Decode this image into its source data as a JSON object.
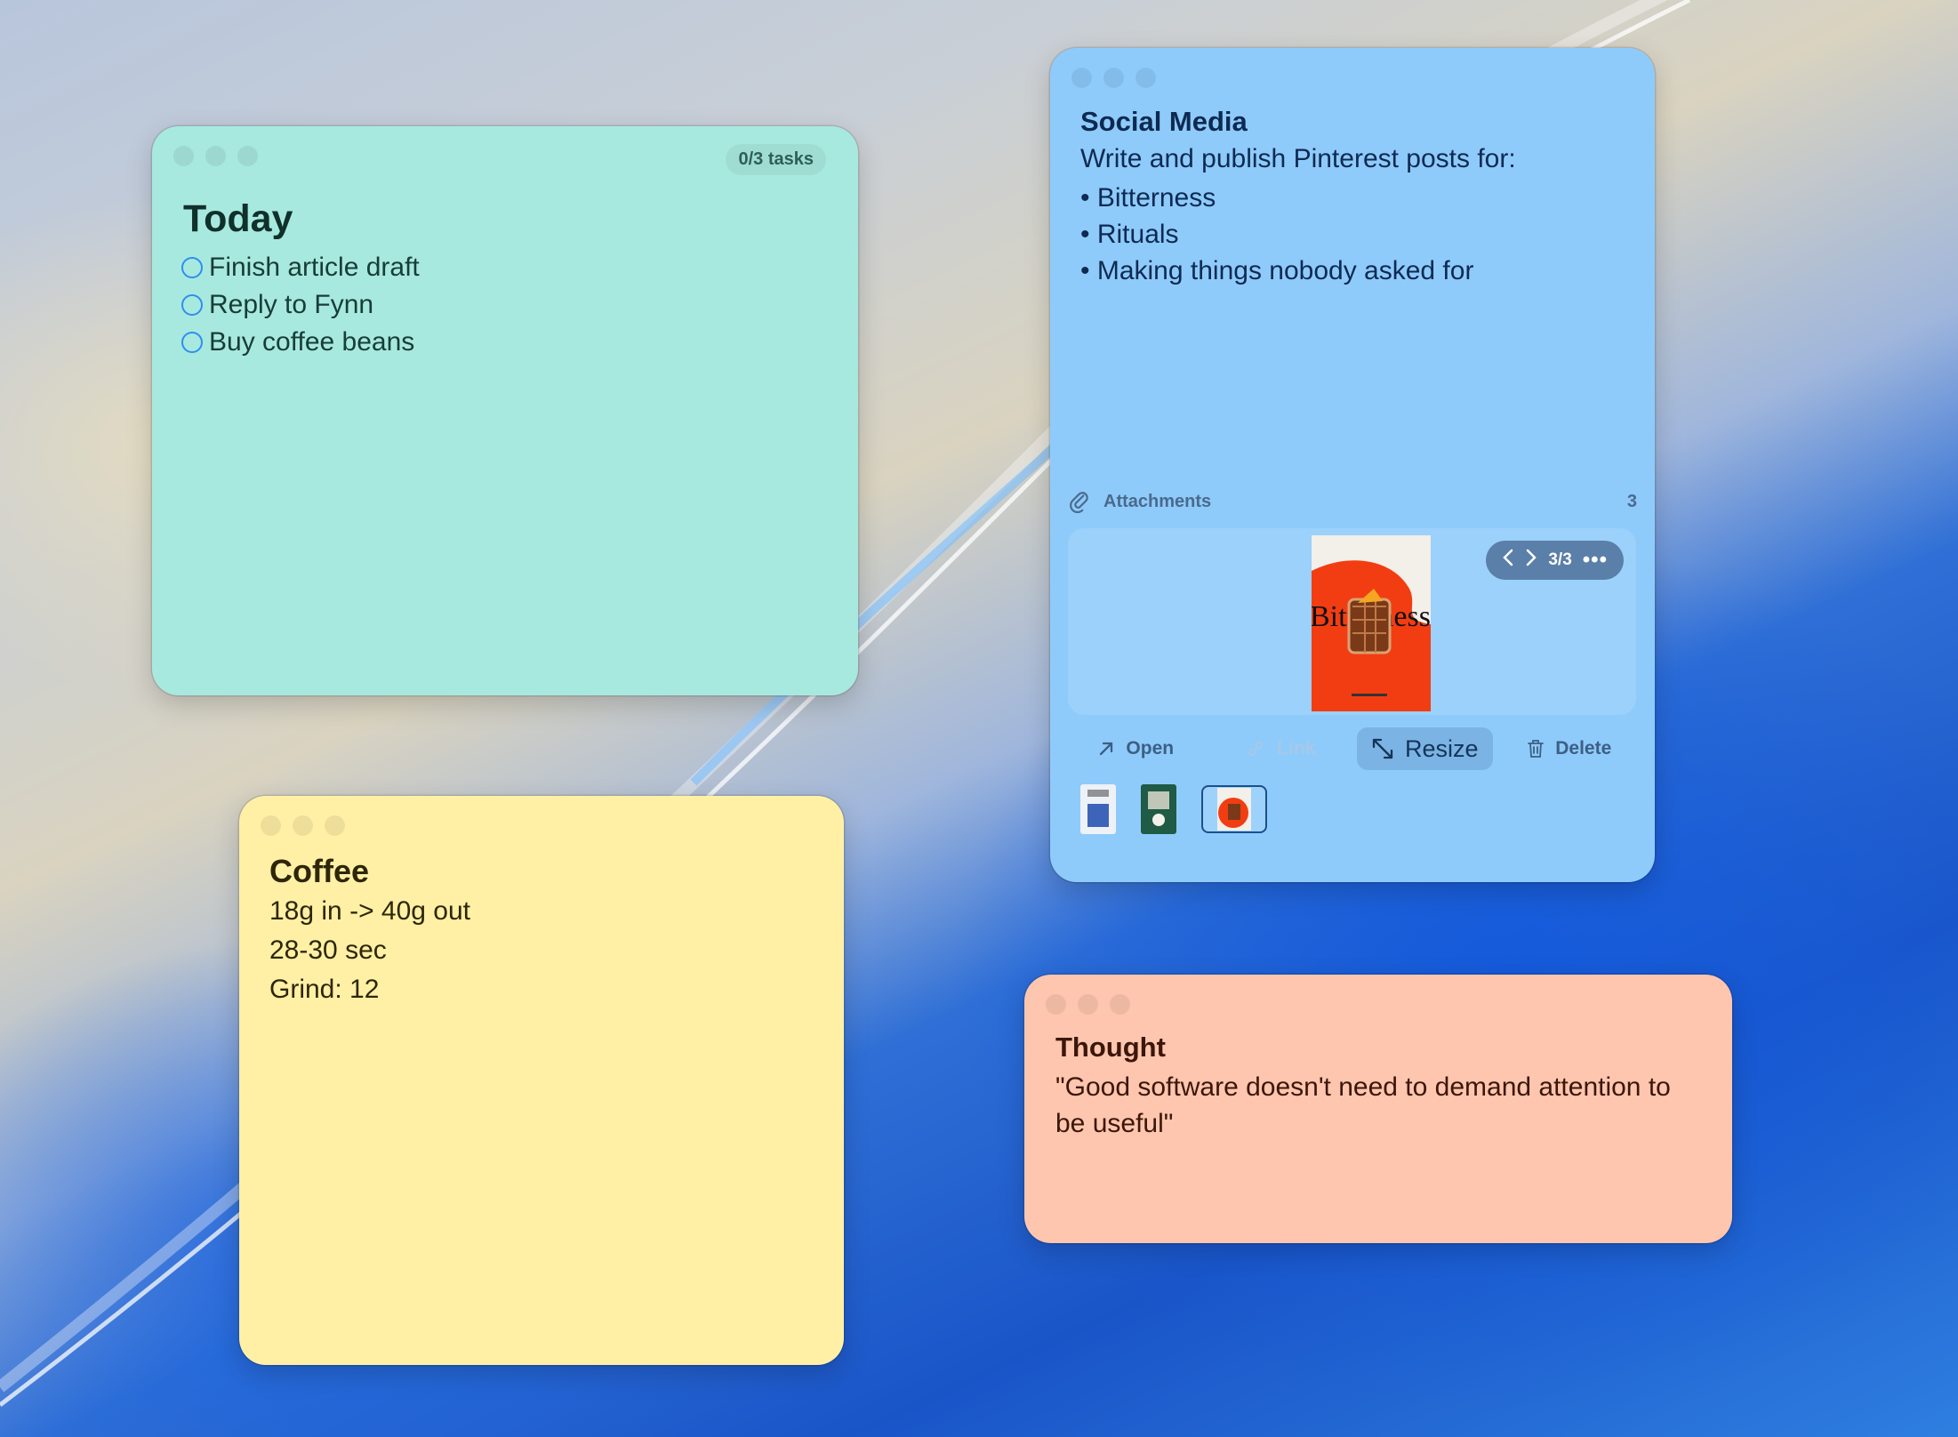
{
  "desktop": {
    "wallpaper": "blue-swoosh"
  },
  "notes": {
    "today": {
      "title": "Today",
      "task_count": "0/3 tasks",
      "tasks": [
        {
          "label": "Finish article draft",
          "done": false
        },
        {
          "label": "Reply to Fynn",
          "done": false
        },
        {
          "label": "Buy coffee beans",
          "done": false
        }
      ],
      "color": "#a8e9df"
    },
    "coffee": {
      "title": "Coffee",
      "lines": [
        "18g in -> 40g out",
        "28-30 sec",
        "Grind: 12"
      ],
      "color": "#fff0a6"
    },
    "social": {
      "title": "Social Media",
      "intro": "Write and publish Pinterest posts for:",
      "bullets": [
        "Bitterness",
        "Rituals",
        "Making things nobody asked for"
      ],
      "attachments": {
        "label": "Attachments",
        "count": "3",
        "pager": "3/3",
        "preview_text": "Bitterness",
        "actions": {
          "open": "Open",
          "link": "Link",
          "resize": "Resize",
          "delete": "Delete"
        },
        "thumbnails": [
          "attachment-1",
          "attachment-2",
          "attachment-3"
        ],
        "selected_index": 3
      },
      "color": "#8ecbfb"
    },
    "thought": {
      "title": "Thought",
      "body": "\"Good software doesn't need to demand attention to be useful\"",
      "color": "#fec6ae"
    }
  }
}
